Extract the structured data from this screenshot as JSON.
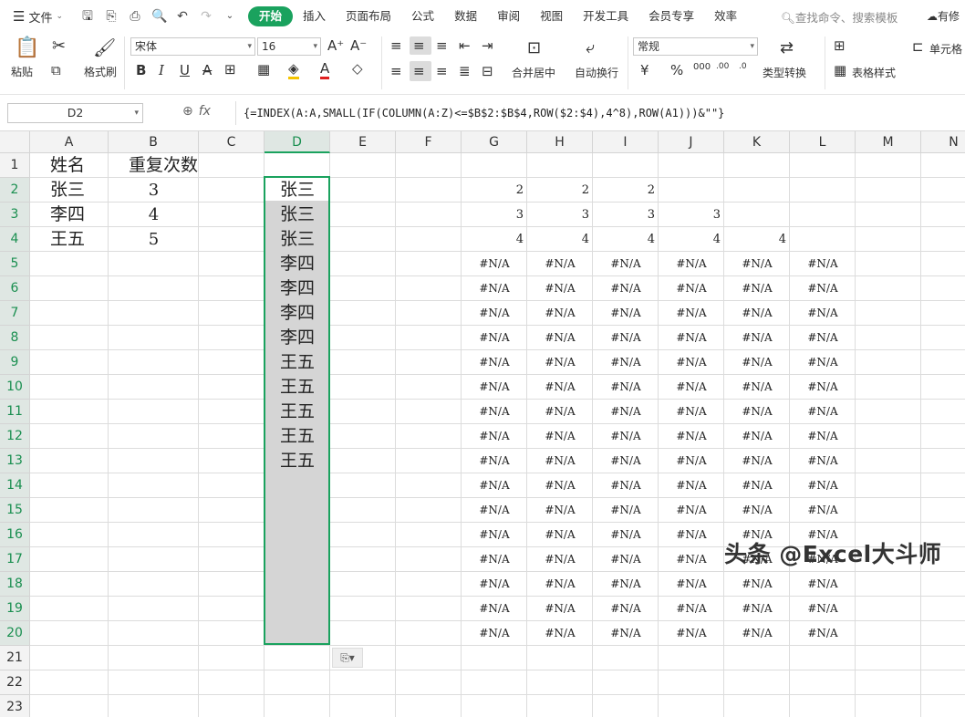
{
  "menu": {
    "label": "文件"
  },
  "tabs": [
    "开始",
    "插入",
    "页面布局",
    "公式",
    "数据",
    "审阅",
    "视图",
    "开发工具",
    "会员专享",
    "效率"
  ],
  "search_cmd": "查找命令、搜索模板",
  "top_right": "有修",
  "ribbon": {
    "paste": "粘贴",
    "format_painter": "格式刷",
    "font_name": "宋体",
    "font_size": "16",
    "merge_center": "合并居中",
    "wrap_text": "自动换行",
    "number_format": "常规",
    "type_convert": "类型转换",
    "table_style": "表格样式",
    "cell": "单元格"
  },
  "formula_bar": {
    "cell_ref": "D2",
    "fx": "fx",
    "formula": "{=INDEX(A:A,SMALL(IF(COLUMN(A:Z)<=$B$2:$B$4,ROW($2:$4),4^8),ROW(A1)))&\"\"}"
  },
  "columns": [
    "A",
    "B",
    "C",
    "D",
    "E",
    "F",
    "G",
    "H",
    "I",
    "J",
    "K",
    "L",
    "M",
    "N"
  ],
  "rows": [
    "1",
    "2",
    "3",
    "4",
    "5",
    "6",
    "7",
    "8",
    "9",
    "10",
    "11",
    "12",
    "13",
    "14",
    "15",
    "16",
    "17",
    "18",
    "19",
    "20",
    "21",
    "22",
    "23"
  ],
  "cells": {
    "A1": "姓名",
    "B1": "重复次数",
    "A2": "张三",
    "B2": "3",
    "A3": "李四",
    "B3": "4",
    "A4": "王五",
    "B4": "5",
    "D": [
      "张三",
      "张三",
      "张三",
      "李四",
      "李四",
      "李四",
      "李四",
      "王五",
      "王五",
      "王五",
      "王五",
      "王五"
    ],
    "G2": "2",
    "H2": "2",
    "I2": "2",
    "G3": "3",
    "H3": "3",
    "I3": "3",
    "J3": "3",
    "G4": "4",
    "H4": "4",
    "I4": "4",
    "J4": "4",
    "K4": "4",
    "na": "#N/A"
  },
  "watermark": "头条 @Excel大斗师"
}
